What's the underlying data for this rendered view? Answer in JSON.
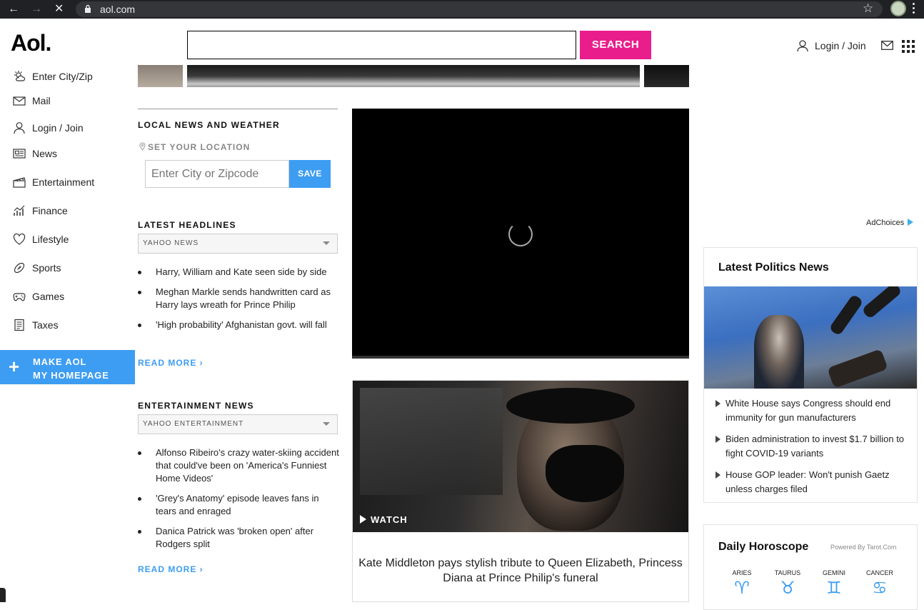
{
  "browser": {
    "url": "aol.com"
  },
  "header": {
    "logo": "Aol.",
    "search_placeholder": "",
    "search_button": "SEARCH",
    "login": "Login / Join"
  },
  "sidebar": {
    "items": [
      {
        "label": "Enter City/Zip",
        "icon": "weather-icon"
      },
      {
        "label": "Mail",
        "icon": "mail-icon"
      },
      {
        "label": "Login / Join",
        "icon": "user-icon"
      },
      {
        "label": "News",
        "icon": "news-icon"
      },
      {
        "label": "Entertainment",
        "icon": "clapper-icon"
      },
      {
        "label": "Finance",
        "icon": "chart-icon"
      },
      {
        "label": "Lifestyle",
        "icon": "heart-icon"
      },
      {
        "label": "Sports",
        "icon": "football-icon"
      },
      {
        "label": "Games",
        "icon": "gamepad-icon"
      },
      {
        "label": "Taxes",
        "icon": "document-icon"
      }
    ],
    "homepage_line1": "MAKE AOL",
    "homepage_line2": "MY HOMEPAGE"
  },
  "local": {
    "title": "LOCAL NEWS AND WEATHER",
    "set_location": "SET YOUR LOCATION",
    "input_placeholder": "Enter City or Zipcode",
    "save": "SAVE"
  },
  "headlines": {
    "title": "LATEST HEADLINES",
    "source": "YAHOO NEWS",
    "items": [
      "Harry, William and Kate seen side by side",
      "Meghan Markle sends handwritten card as Harry lays wreath for Prince Philip",
      "'High probability' Afghanistan govt. will fall"
    ],
    "read_more": "READ MORE ›"
  },
  "entertainment": {
    "title": "ENTERTAINMENT NEWS",
    "source": "YAHOO ENTERTAINMENT",
    "items": [
      "Alfonso Ribeiro's crazy water-skiing accident that could've been on 'America's Funniest Home Videos'",
      "'Grey's Anatomy' episode leaves fans in tears and enraged",
      "Danica Patrick was 'broken open' after Rodgers split"
    ],
    "read_more": "READ MORE ›"
  },
  "feature": {
    "watch": "WATCH",
    "caption": "Kate Middleton pays stylish tribute to Queen Elizabeth, Princess Diana at Prince Philip's funeral"
  },
  "ad": {
    "adchoices": "AdChoices"
  },
  "politics": {
    "title": "Latest Politics News",
    "items": [
      "White House says Congress should end immunity for gun manufacturers",
      "Biden administration to invest $1.7 billion to fight COVID-19 variants",
      "House GOP leader: Won't punish Gaetz unless charges filed"
    ]
  },
  "horoscope": {
    "title": "Daily Horoscope",
    "powered": "Powered By Tarot.Com",
    "signs": [
      {
        "name": "ARIES",
        "symbol": "♈"
      },
      {
        "name": "TAURUS",
        "symbol": "♉"
      },
      {
        "name": "GEMINI",
        "symbol": "♊"
      },
      {
        "name": "CANCER",
        "symbol": "♋"
      }
    ]
  },
  "colors": {
    "search": "#e91e8c",
    "accent": "#3d9df2"
  }
}
